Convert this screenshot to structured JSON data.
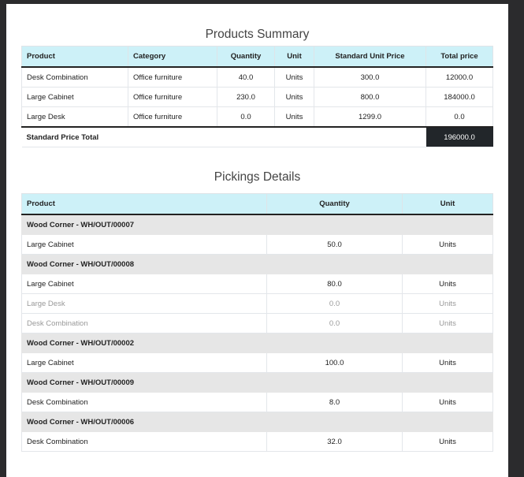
{
  "summary": {
    "title": "Products Summary",
    "headers": [
      "Product",
      "Category",
      "Quantity",
      "Unit",
      "Standard Unit Price",
      "Total price"
    ],
    "rows": [
      [
        "Desk Combination",
        "Office furniture",
        "40.0",
        "Units",
        "300.0",
        "12000.0"
      ],
      [
        "Large Cabinet",
        "Office furniture",
        "230.0",
        "Units",
        "800.0",
        "184000.0"
      ],
      [
        "Large Desk",
        "Office furniture",
        "0.0",
        "Units",
        "1299.0",
        "0.0"
      ]
    ],
    "total_label": "Standard Price Total",
    "total_value": "196000.0"
  },
  "pickings": {
    "title": "Pickings Details",
    "headers": [
      "Product",
      "Quantity",
      "Unit"
    ],
    "groups": [
      {
        "name": "Wood Corner - WH/OUT/00007",
        "rows": [
          [
            "Large Cabinet",
            "50.0",
            "Units"
          ]
        ]
      },
      {
        "name": "Wood Corner - WH/OUT/00008",
        "rows": [
          [
            "Large Cabinet",
            "80.0",
            "Units"
          ],
          [
            "Large Desk",
            "0.0",
            "Units"
          ],
          [
            "Desk Combination",
            "0.0",
            "Units"
          ]
        ]
      },
      {
        "name": "Wood Corner - WH/OUT/00002",
        "rows": [
          [
            "Large Cabinet",
            "100.0",
            "Units"
          ]
        ]
      },
      {
        "name": "Wood Corner - WH/OUT/00009",
        "rows": [
          [
            "Desk Combination",
            "8.0",
            "Units"
          ]
        ]
      },
      {
        "name": "Wood Corner - WH/OUT/00006",
        "rows": [
          [
            "Desk Combination",
            "32.0",
            "Units"
          ]
        ]
      }
    ]
  }
}
